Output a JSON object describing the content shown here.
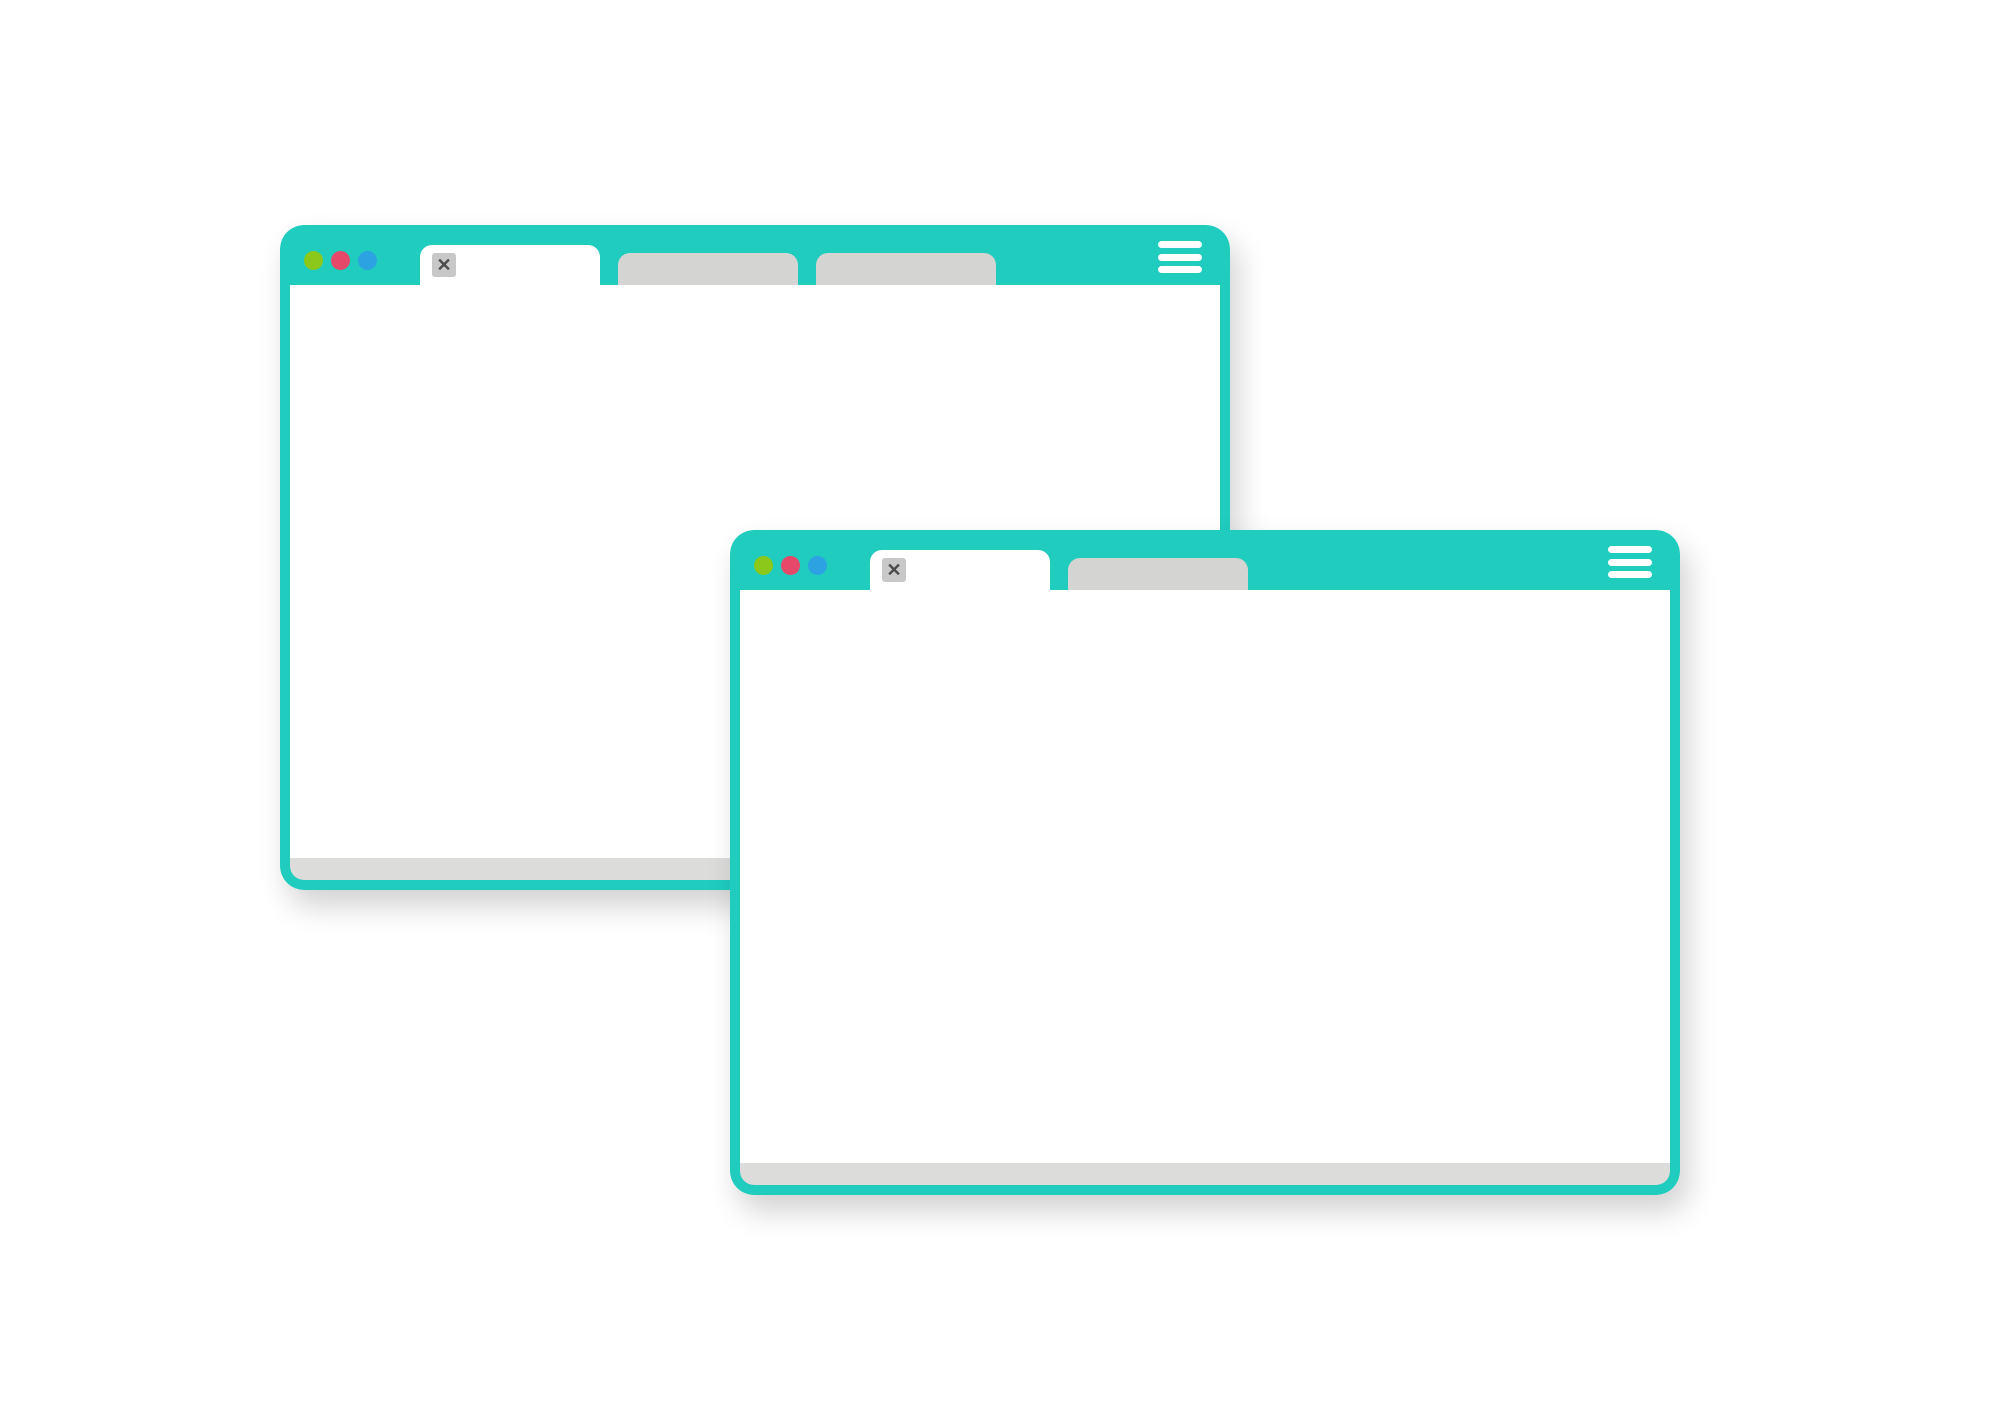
{
  "colors": {
    "frame": "#1fccbe",
    "tab_inactive": "#d4d4d3",
    "tab_active": "#ffffff",
    "status_bar": "#dcdcdb",
    "traffic_close": "#8bc819",
    "traffic_min": "#e64869",
    "traffic_max": "#2ca2e3"
  },
  "window_back": {
    "tabs": [
      {
        "active": true,
        "close_glyph": "✕"
      },
      {
        "active": false
      },
      {
        "active": false
      }
    ]
  },
  "window_front": {
    "tabs": [
      {
        "active": true,
        "close_glyph": "✕"
      },
      {
        "active": false
      }
    ]
  }
}
